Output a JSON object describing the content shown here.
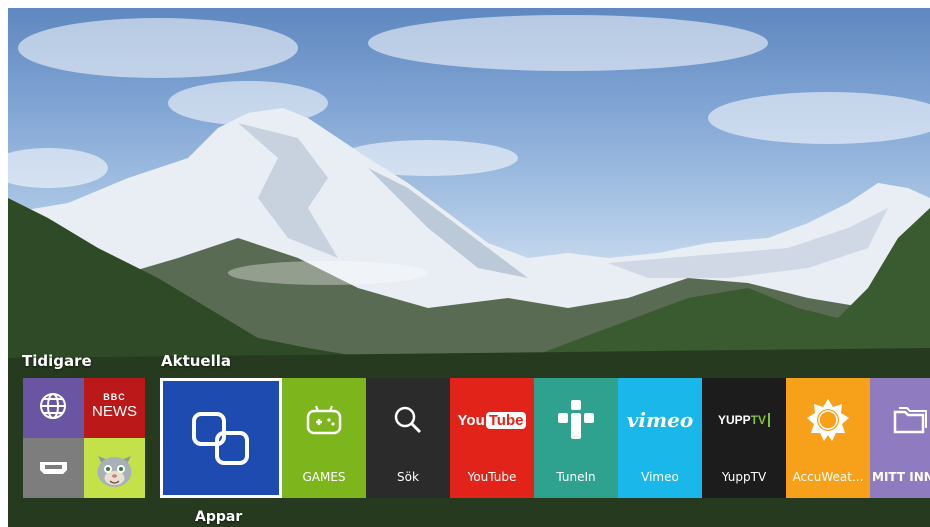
{
  "sections": {
    "previous_label": "Tidigare",
    "current_label": "Aktuella"
  },
  "previous": {
    "bbc_line1": "BBC",
    "bbc_line2": "NEWS"
  },
  "focused": {
    "label": "Appar"
  },
  "apps": [
    {
      "label": "GAMES",
      "color": "#7db61c"
    },
    {
      "label": "Sök",
      "color": "#2b2b2b"
    },
    {
      "label": "YouTube",
      "color": "#e2231a"
    },
    {
      "label": "TuneIn",
      "color": "#2ea28f"
    },
    {
      "label": "Vimeo",
      "color": "#1ab7ea"
    },
    {
      "label": "YuppTV",
      "color": "#1c1c1c"
    },
    {
      "label": "AccuWeat...",
      "color": "#f7a11a"
    },
    {
      "label": "MITT INNEHÅLL",
      "color": "#8e7bc0"
    }
  ],
  "logos": {
    "youtube_you": "You",
    "youtube_tube": "Tube",
    "vimeo": "vimeo",
    "yupptv_a": "YUPP",
    "yupptv_b": "TV"
  }
}
